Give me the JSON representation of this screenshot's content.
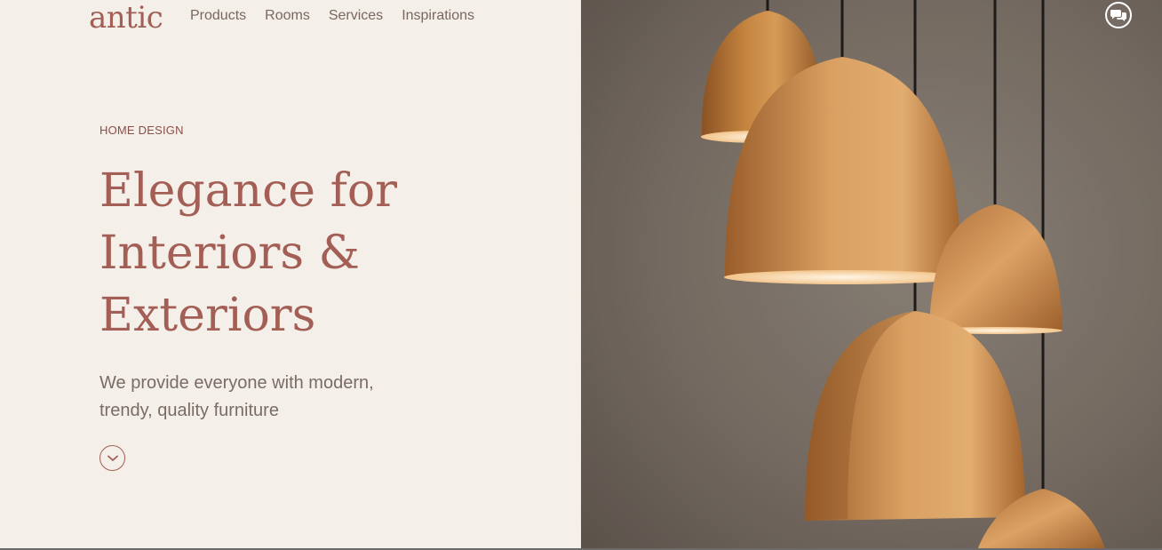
{
  "brand": {
    "logo_text": "antic"
  },
  "nav": {
    "items": [
      {
        "label": "Products"
      },
      {
        "label": "Rooms"
      },
      {
        "label": "Services"
      },
      {
        "label": "Inspirations"
      }
    ]
  },
  "hero": {
    "eyebrow": "HOME DESIGN",
    "headline_lines": [
      "Elegance for",
      "Interiors &",
      "Exteriors"
    ],
    "lead": "We provide everyone with modern, trendy, quality furniture",
    "scroll_icon": "chevron-down-icon",
    "image": "copper-pendant-lamps"
  },
  "chat": {
    "icon": "chat-bubbles-icon"
  },
  "colors": {
    "accent": "#a35f55",
    "background": "#f4efe9",
    "nav_text": "#7a6760",
    "body_text": "#7a6b66",
    "copper": "#c98a4b"
  }
}
